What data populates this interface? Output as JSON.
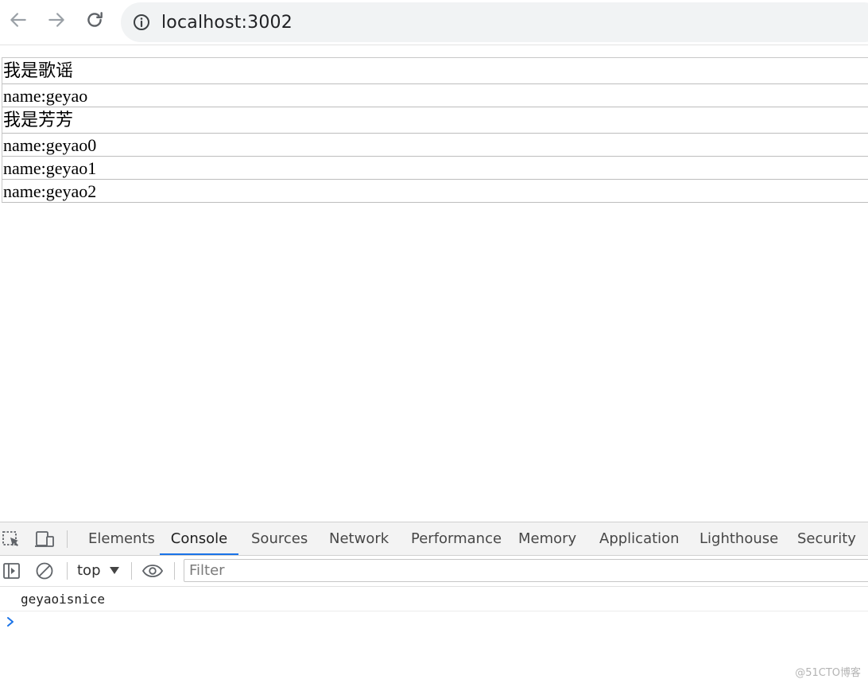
{
  "browser": {
    "url": "localhost:3002"
  },
  "page": {
    "rows": [
      {
        "text": "我是歌谣"
      },
      {
        "text": "name:geyao"
      },
      {
        "text": "我是芳芳"
      },
      {
        "text": "name:geyao0"
      },
      {
        "text": "name:geyao1"
      },
      {
        "text": "name:geyao2"
      }
    ]
  },
  "devtools": {
    "tabs": [
      {
        "label": "Elements"
      },
      {
        "label": "Console"
      },
      {
        "label": "Sources"
      },
      {
        "label": "Network"
      },
      {
        "label": "Performance"
      },
      {
        "label": "Memory"
      },
      {
        "label": "Application"
      },
      {
        "label": "Lighthouse"
      },
      {
        "label": "Security"
      }
    ],
    "active_tab": "Console",
    "context": "top",
    "filter_placeholder": "Filter",
    "messages": [
      {
        "text": "geyaoisnice"
      }
    ]
  },
  "watermark": "@51CTO博客",
  "colors": {
    "active_tab_underline": "#1a73e8",
    "prompt": "#1a73e8"
  }
}
